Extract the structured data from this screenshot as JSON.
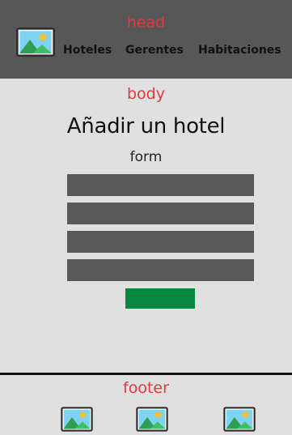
{
  "header": {
    "section_label": "head",
    "logo_icon": "image-placeholder-icon",
    "nav": [
      {
        "label": "Hoteles"
      },
      {
        "label": "Gerentes"
      },
      {
        "label": "Habitaciones"
      }
    ]
  },
  "main": {
    "section_label": "body",
    "title": "Añadir un hotel",
    "form_label": "form",
    "fields": [
      {
        "value": "",
        "placeholder": ""
      },
      {
        "value": "",
        "placeholder": ""
      },
      {
        "value": "",
        "placeholder": ""
      },
      {
        "value": "",
        "placeholder": ""
      }
    ],
    "submit_label": ""
  },
  "footer": {
    "section_label": "footer",
    "icons": [
      "image-placeholder-icon",
      "image-placeholder-icon",
      "image-placeholder-icon"
    ]
  },
  "colors": {
    "header_bg": "#575757",
    "page_bg": "#e0e0e0",
    "label_red": "#e0393e",
    "field_bg": "#595959",
    "submit_bg": "#07873f"
  }
}
